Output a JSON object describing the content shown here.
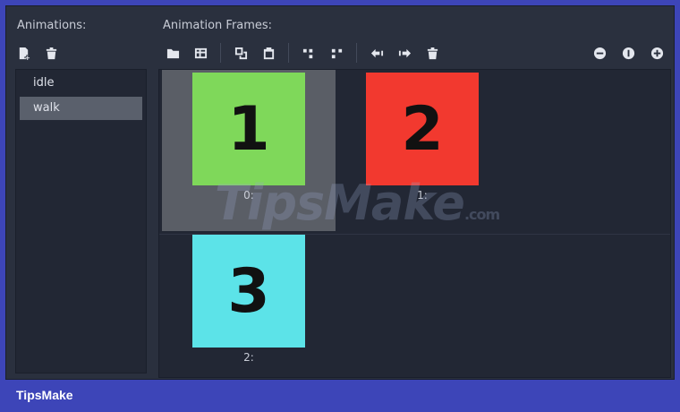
{
  "left_panel": {
    "title": "Animations:",
    "items": [
      {
        "label": "idle"
      },
      {
        "label": "walk"
      }
    ]
  },
  "right_panel": {
    "title": "Animation Frames:",
    "frames": [
      {
        "label": "0:",
        "number": "1",
        "color": "#7fd85a"
      },
      {
        "label": "1:",
        "number": "2",
        "color": "#f2392f"
      },
      {
        "label": "2:",
        "number": "3",
        "color": "#5ce3e8"
      }
    ],
    "selected_frame": "0:"
  },
  "selected_animation": "walk",
  "watermark": {
    "main": "TipsMake",
    "suffix": ".com"
  },
  "footer": {
    "brand": "TipsMake"
  },
  "colors": {
    "border": "#3d45b8",
    "panel": "#2a303e",
    "list_bg": "#222734",
    "selection": "#5a606c"
  }
}
